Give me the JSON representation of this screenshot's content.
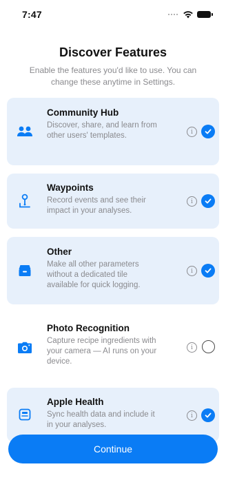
{
  "status_bar": {
    "time": "7:47"
  },
  "header": {
    "title": "Discover Features",
    "subtitle": "Enable the features you'd like to use. You can change these anytime in Settings."
  },
  "features": [
    {
      "title": "Community Hub",
      "description": "Discover, share, and learn from other users' templates.",
      "enabled": true,
      "icon": "people-icon"
    },
    {
      "title": "Waypoints",
      "description": "Record events and see their impact in your analyses.",
      "enabled": true,
      "icon": "waypoint-icon"
    },
    {
      "title": "Other",
      "description": "Make all other parameters without a dedicated tile available for quick logging.",
      "enabled": true,
      "icon": "tray-icon"
    },
    {
      "title": "Photo Recognition",
      "description": "Capture recipe ingredients with your camera — AI runs on your device.",
      "enabled": false,
      "icon": "camera-icon"
    },
    {
      "title": "Apple Health",
      "description": "Sync health data and include it in your analyses.",
      "enabled": true,
      "icon": "health-record-icon"
    }
  ],
  "info_glyph": "i",
  "continue_label": "Continue",
  "colors": {
    "accent": "#0a7cf5",
    "card_selected": "#e7f0fb",
    "muted_text": "#8a8a8e"
  }
}
